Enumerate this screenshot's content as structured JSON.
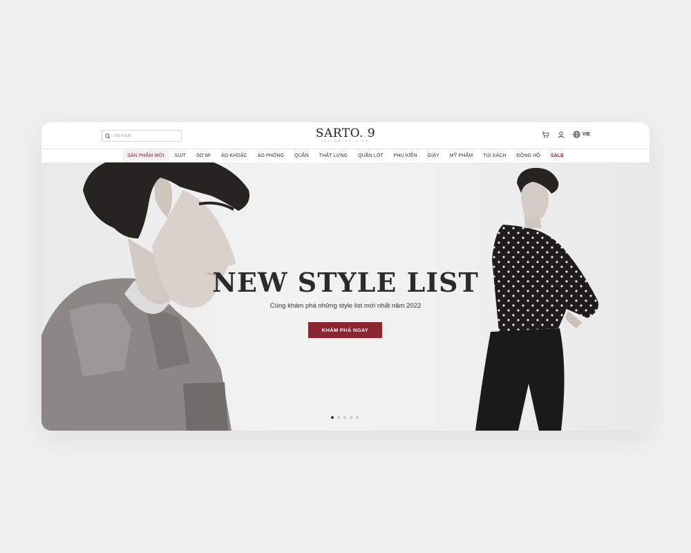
{
  "brand": {
    "name": "SARTO. 9",
    "tagline": "TAILORING & CO"
  },
  "search": {
    "placeholder": "TÌM KIẾM"
  },
  "header": {
    "language": "VIE"
  },
  "nav": {
    "items": [
      {
        "label": "SẢN PHẨM MỚI"
      },
      {
        "label": "SUIT"
      },
      {
        "label": "SƠ MI"
      },
      {
        "label": "ÁO KHOÁC"
      },
      {
        "label": "ÁO PHÔNG"
      },
      {
        "label": "QUẦN"
      },
      {
        "label": "THẮT LƯNG"
      },
      {
        "label": "QUẦN LÓT"
      },
      {
        "label": "PHỤ KIỆN"
      },
      {
        "label": "GIÀY"
      },
      {
        "label": "MỸ PHẨM"
      },
      {
        "label": "TÚI XÁCH"
      },
      {
        "label": "ĐỒNG HỒ"
      },
      {
        "label": "SALE"
      }
    ],
    "active_index": 0
  },
  "hero": {
    "title": "NEW STYLE LIST",
    "subtitle": "Cùng khám phá những style list mới nhất năm 2022",
    "cta_label": "KHÁM PHÁ NGAY",
    "slide_count": 5,
    "active_slide": 1
  },
  "icons": {
    "search": "search-icon",
    "cart": "cart-icon",
    "account": "user-icon",
    "language": "globe-icon"
  },
  "colors": {
    "accent": "#8b2631",
    "page_background": "#efefef",
    "text": "#2b2b2b"
  }
}
